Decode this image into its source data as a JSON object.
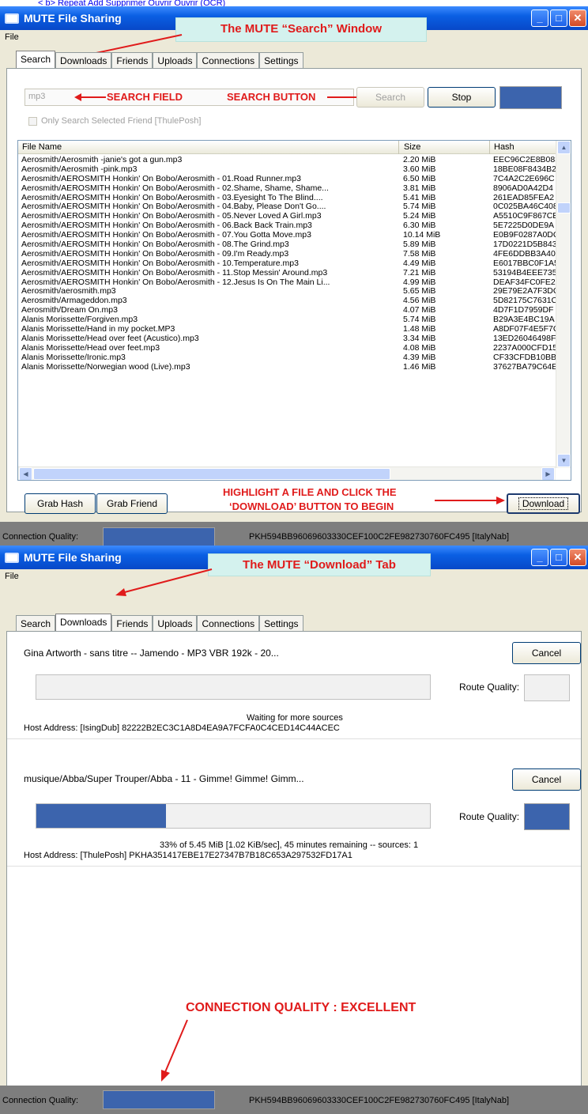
{
  "top_link": "< b> Repeat Add Supprimer Ouvrir Ouvrir (OCR)",
  "win1": {
    "title": "MUTE File Sharing",
    "menu_file": "File",
    "callout": "The MUTE “Search” Window",
    "tabs": [
      "Search",
      "Downloads",
      "Friends",
      "Uploads",
      "Connections",
      "Settings"
    ],
    "active_tab": "Search",
    "search_value": "mp3",
    "search_button": "Search",
    "stop_button": "Stop",
    "only_search_friend": "Only Search Selected Friend [ThulePosh]",
    "annot_search_field": "SEARCH FIELD",
    "annot_search_button": "SEARCH BUTTON",
    "columns": [
      "File Name",
      "Size",
      "Hash"
    ],
    "rows": [
      [
        "Aerosmith/Aerosmith -janie's got a gun.mp3",
        "2.20 MiB",
        "EEC96C2E8B083"
      ],
      [
        "Aerosmith/Aerosmith -pink.mp3",
        "3.60 MiB",
        "18BE08F8434B2"
      ],
      [
        "Aerosmith/AEROSMITH Honkin' On Bobo/Aerosmith - 01.Road Runner.mp3",
        "6.50 MiB",
        "7C4A2C2E696C"
      ],
      [
        "Aerosmith/AEROSMITH Honkin' On Bobo/Aerosmith - 02.Shame, Shame, Shame...",
        "3.81 MiB",
        "8906AD0A42D4"
      ],
      [
        "Aerosmith/AEROSMITH Honkin' On Bobo/Aerosmith - 03.Eyesight To The Blind....",
        "5.41 MiB",
        "261EAD85FEA2"
      ],
      [
        "Aerosmith/AEROSMITH Honkin' On Bobo/Aerosmith - 04.Baby, Please Don't Go....",
        "5.74 MiB",
        "0C025BA46C408"
      ],
      [
        "Aerosmith/AEROSMITH Honkin' On Bobo/Aerosmith - 05.Never Loved A Girl.mp3",
        "5.24 MiB",
        "A5510C9F867CE"
      ],
      [
        "Aerosmith/AEROSMITH Honkin' On Bobo/Aerosmith - 06.Back Back Train.mp3",
        "6.30 MiB",
        "5E7225D0DE9A"
      ],
      [
        "Aerosmith/AEROSMITH Honkin' On Bobo/Aerosmith - 07.You Gotta Move.mp3",
        "10.14 MiB",
        "E0B9F0287A0DC"
      ],
      [
        "Aerosmith/AEROSMITH Honkin' On Bobo/Aerosmith - 08.The Grind.mp3",
        "5.89 MiB",
        "17D0221D5B843"
      ],
      [
        "Aerosmith/AEROSMITH Honkin' On Bobo/Aerosmith - 09.I'm Ready.mp3",
        "7.58 MiB",
        "4FE6DDBB3A40"
      ],
      [
        "Aerosmith/AEROSMITH Honkin' On Bobo/Aerosmith - 10.Temperature.mp3",
        "4.49 MiB",
        "E6017BBC0F1A5"
      ],
      [
        "Aerosmith/AEROSMITH Honkin' On Bobo/Aerosmith - 11.Stop Messin' Around.mp3",
        "7.21 MiB",
        "53194B4EEE735"
      ],
      [
        "Aerosmith/AEROSMITH Honkin' On Bobo/Aerosmith - 12.Jesus Is On The Main Li...",
        "4.99 MiB",
        "DEAF34FC0FE2"
      ],
      [
        "Aerosmith/aerosmith.mp3",
        "5.65 MiB",
        "29E79E2A7F3DC"
      ],
      [
        "Aerosmith/Armageddon.mp3",
        "4.56 MiB",
        "5D82175C7631C"
      ],
      [
        "Aerosmith/Dream On.mp3",
        "4.07 MiB",
        "4D7F1D7959DF"
      ],
      [
        "Alanis Morissette/Forgiven.mp3",
        "5.74 MiB",
        "B29A3E4BC19A"
      ],
      [
        "Alanis Morissette/Hand in my pocket.MP3",
        "1.48 MiB",
        "A8DF07F4E5F7C"
      ],
      [
        "Alanis Morissette/Head over feet (Acustico).mp3",
        "3.34 MiB",
        "13ED26046498F"
      ],
      [
        "Alanis Morissette/Head over feet.mp3",
        "4.08 MiB",
        "2237A000CFD15"
      ],
      [
        "Alanis Morissette/Ironic.mp3",
        "4.39 MiB",
        "CF33CFDB10BB"
      ],
      [
        "Alanis Morissette/Norwegian wood (Live).mp3",
        "1.46 MiB",
        "37627BA79C64E"
      ]
    ],
    "grab_hash": "Grab Hash",
    "grab_friend": "Grab Friend",
    "download_button": "Download",
    "annot_download_1": "HIGHLIGHT A FILE AND CLICK THE",
    "annot_download_2": "‘DOWNLOAD’ BUTTON TO BEGIN",
    "connection_quality": "Connection Quality:",
    "node_id": "PKH594BB96069603330CEF100C2FE982730760FC495 [ItalyNab]"
  },
  "win2": {
    "title": "MUTE File Sharing",
    "menu_file": "File",
    "callout": "The MUTE “Download” Tab",
    "tabs": [
      "Search",
      "Downloads",
      "Friends",
      "Uploads",
      "Connections",
      "Settings"
    ],
    "active_tab": "Downloads",
    "downloads": [
      {
        "name": "Gina Artworth - sans titre -- Jamendo - MP3 VBR 192k - 20...",
        "cancel": "Cancel",
        "route_quality": "Route Quality:",
        "progress": 0,
        "status": "Waiting for more sources",
        "host": "Host Address:  [IsingDub] 82222B2EC3C1A8D4EA9A7FCFA0C4CED14C44ACEC"
      },
      {
        "name": "musique/Abba/Super Trouper/Abba - 11 - Gimme! Gimme! Gimm...",
        "cancel": "Cancel",
        "route_quality": "Route Quality:",
        "progress": 0.33,
        "status": "33% of 5.45 MiB [1.02 KiB/sec], 45 minutes remaining -- sources: 1",
        "host": "Host Address:  [ThulePosh] PKHA351417EBE17E27347B7B18C653A297532FD17A1"
      }
    ],
    "annot_connection": "CONNECTION QUALITY : EXCELLENT",
    "connection_quality": "Connection Quality:",
    "node_id": "PKH594BB96069603330CEF100C2FE982730760FC495 [ItalyNab]"
  },
  "colors": {
    "accent_blue": "#3c64ad",
    "annotation_red": "#e01b1b",
    "callout_bg": "#d4f2ee"
  }
}
